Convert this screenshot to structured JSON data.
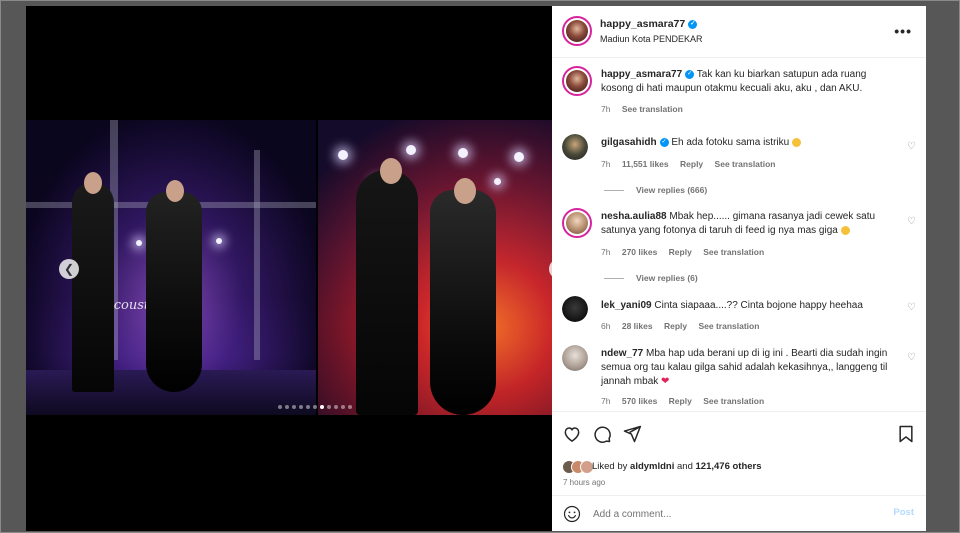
{
  "header": {
    "username": "happy_asmara77",
    "location": "Madiun Kota PENDEKAR",
    "verified": true,
    "more_icon": "more-horizontal-icon"
  },
  "media": {
    "stage_text": "acoustic",
    "carousel_dots_total": 11,
    "carousel_active_index": 6,
    "prev_icon": "chevron-left-icon",
    "next_icon": "chevron-right-icon"
  },
  "caption": {
    "username": "happy_asmara77",
    "text": "Tak kan ku biarkan satupun ada ruang kosong di hati maupun otakmu kecuali aku, aku , dan AKU.",
    "time": "7h",
    "see_translation": "See translation"
  },
  "comments": [
    {
      "username": "gilgasahidh",
      "verified": true,
      "text": "Eh ada fotoku sama istriku",
      "emoji": "🥲",
      "time": "7h",
      "likes": "11,551 likes",
      "reply": "Reply",
      "see_translation": "See translation",
      "view_replies": "View replies (666)"
    },
    {
      "username": "nesha.aulia88",
      "verified": false,
      "text": "Mbak hep...... gimana rasanya jadi cewek satu satunya yang fotonya di taruh di feed ig nya mas giga",
      "emoji": "😍",
      "time": "7h",
      "likes": "270 likes",
      "reply": "Reply",
      "see_translation": "See translation",
      "view_replies": "View replies (6)"
    },
    {
      "username": "lek_yani09",
      "verified": false,
      "text": "Cinta siapaaa....?? Cinta bojone happy heehaa",
      "emoji": "",
      "time": "6h",
      "likes": "28 likes",
      "reply": "Reply",
      "see_translation": "See translation",
      "view_replies": ""
    },
    {
      "username": "ndew_77",
      "verified": false,
      "text": "Mba hap uda berani up di ig ini . Bearti dia sudah ingin semua org tau kalau gilga sahid adalah kekasihnya,, langgeng til jannah mbak",
      "emoji": "❤️",
      "time": "7h",
      "likes": "570 likes",
      "reply": "Reply",
      "see_translation": "See translation",
      "view_replies": ""
    }
  ],
  "actions": {
    "like_icon": "heart-icon",
    "comment_icon": "comment-icon",
    "share_icon": "share-icon",
    "save_icon": "bookmark-icon",
    "liked_by_prefix": "Liked by",
    "liked_by_user": "aldymldni",
    "liked_by_suffix_and": "and",
    "liked_by_others": "121,476 others",
    "time_ago": "7 hours ago"
  },
  "add_comment": {
    "placeholder": "Add a comment...",
    "post_label": "Post",
    "emoji_icon": "smiley-icon"
  },
  "colors": {
    "link_blue": "#0095f6",
    "post_disabled": "#b3dbff",
    "heart_red": "#e0245e",
    "story_ring": "#d6249f"
  }
}
